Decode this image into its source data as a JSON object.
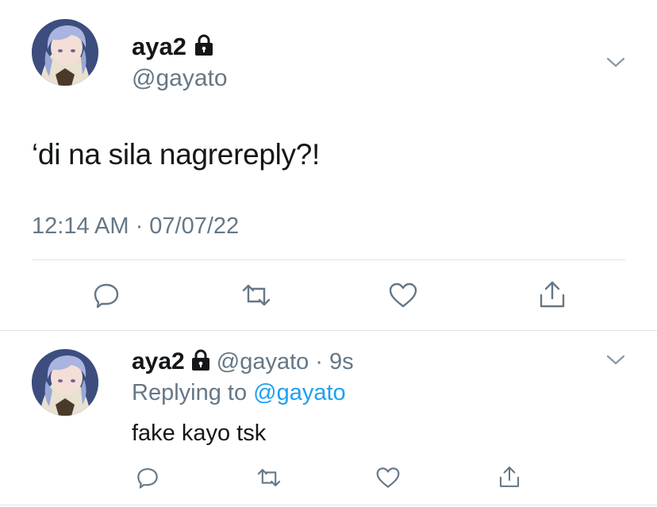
{
  "main_tweet": {
    "display_name": "aya2",
    "handle": "@gayato",
    "text": "‘di na sila nagrereply?!",
    "timestamp": "12:14 AM · 07/07/22",
    "protected_icon": "lock-icon",
    "menu_icon": "chevron-down-icon",
    "actions": [
      "reply-icon",
      "retweet-icon",
      "like-icon",
      "share-icon"
    ]
  },
  "reply_tweet": {
    "display_name": "aya2",
    "handle": "@gayato",
    "time_ago": "· 9s",
    "replying_prefix": "Replying to",
    "replying_handle": "@gayato",
    "text": "fake kayo tsk",
    "protected_icon": "lock-icon",
    "menu_icon": "chevron-down-icon",
    "actions": [
      "reply-icon",
      "retweet-icon",
      "like-icon",
      "share-icon"
    ]
  },
  "colors": {
    "text": "#14171a",
    "muted": "#657786",
    "link": "#1da1f2",
    "divider": "#dfe3e7"
  }
}
